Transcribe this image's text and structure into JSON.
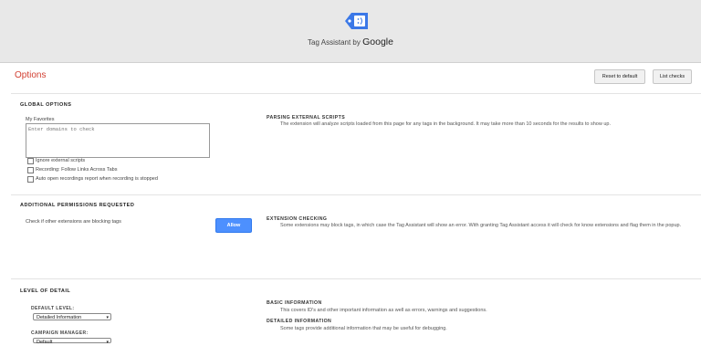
{
  "header": {
    "brand_prefix": "Tag Assistant by",
    "brand_name": "Google",
    "logo_icon": "tag-icon"
  },
  "options_title": "Options",
  "buttons": {
    "reset": "Reset to default",
    "list_checks": "List checks",
    "allow": "Allow"
  },
  "global_options": {
    "title": "GLOBAL OPTIONS",
    "favorites_label": "My Favorites",
    "favorites_placeholder": "Enter domains to check",
    "checkboxes": [
      {
        "label": "Ignore external scripts",
        "checked": false
      },
      {
        "label": "Recording: Follow Links Across Tabs",
        "checked": false
      },
      {
        "label": "Auto open recordings report when recording is stopped",
        "checked": false
      }
    ],
    "info_title": "PARSING EXTERNAL SCRIPTS",
    "info_text": "The extension will analyze scripts loaded from this page for any tags in the background. It may take more than 10 seconds for the results to show up."
  },
  "permissions": {
    "title": "ADDITIONAL PERMISSIONS REQUESTED",
    "text": "Check if other extensions are blocking tags",
    "info_title": "EXTENSION CHECKING",
    "info_text": "Some extensions may block tags, in which case the Tag Assistant will show an error. With granting Tag Assistant access it will check for know extensions and flag them in the popup."
  },
  "level_of_detail": {
    "title": "LEVEL OF DETAIL",
    "default_label": "DEFAULT LEVEL:",
    "default_value": "Detailed Information",
    "campaign_label": "CAMPAIGN MANAGER:",
    "campaign_value": "Default",
    "basic_title": "BASIC INFORMATION",
    "basic_text": "This covers ID's and other important information as well as errors, warnings and suggestions.",
    "detailed_title": "DETAILED INFORMATION",
    "detailed_text": "Some tags provide additional information that may be useful for debugging."
  },
  "colors": {
    "accent": "#d23f31",
    "header_bg": "#e8e8e8",
    "allow_bg": "#4d90fe",
    "logo": "#3b78e7"
  }
}
